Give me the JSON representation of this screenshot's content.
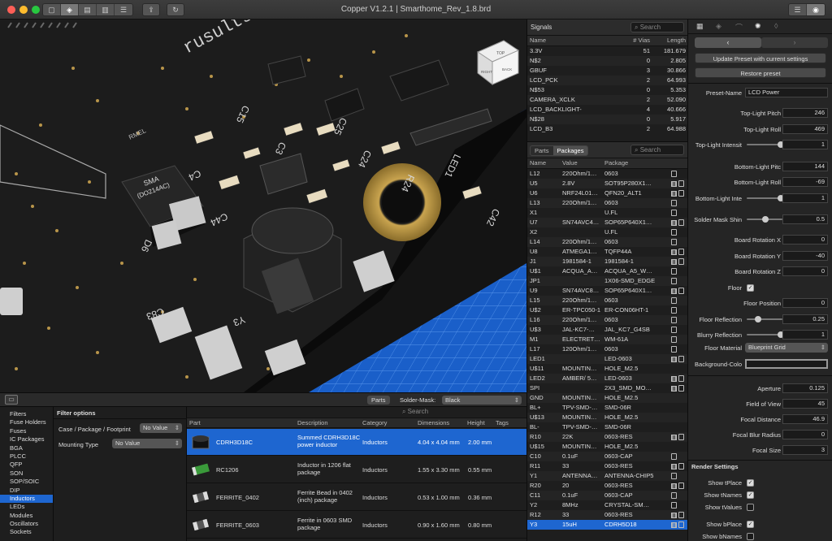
{
  "window": {
    "title": "Copper V1.2.1 | Smarthome_Rev_1.8.brd"
  },
  "colors": {
    "accent": "#1e66d0",
    "board": "#1b1b1b",
    "floor": "#1a5fc9"
  },
  "viewport": {
    "cube_top": "TOP",
    "cube_right": "RIGHT",
    "cube_back": "BACK",
    "silk_rusults": "rusults.com",
    "silk_rmel": "RMEL",
    "silk_sma": "SMA",
    "silk_sma2": "(DO214AC)",
    "labels": [
      "C4",
      "C44",
      "C42",
      "C83",
      "Y3",
      "D6",
      "R24",
      "C24",
      "C25",
      "C15",
      "C3",
      "LED1"
    ]
  },
  "signals": {
    "title": "Signals",
    "search_placeholder": "Search",
    "columns": {
      "name": "Name",
      "vias": "# Vias",
      "length": "Length"
    },
    "rows": [
      {
        "name": "3.3V",
        "vias": "51",
        "length": "181.679"
      },
      {
        "name": "N$2",
        "vias": "0",
        "length": "2.805"
      },
      {
        "name": "GBUF",
        "vias": "3",
        "length": "30.866"
      },
      {
        "name": "LCD_PCK",
        "vias": "2",
        "length": "64.993"
      },
      {
        "name": "N$53",
        "vias": "0",
        "length": "5.353"
      },
      {
        "name": "CAMERA_XCLK",
        "vias": "2",
        "length": "52.090"
      },
      {
        "name": "LCD_BACKLIGHT-",
        "vias": "4",
        "length": "40.666"
      },
      {
        "name": "N$28",
        "vias": "0",
        "length": "5.917"
      },
      {
        "name": "LCD_B3",
        "vias": "2",
        "length": "64.988"
      }
    ]
  },
  "parts_panel": {
    "tab_parts": "Parts",
    "tab_packages": "Packages",
    "search_placeholder": "Search",
    "columns": {
      "name": "Name",
      "value": "Value",
      "package": "Package"
    },
    "rows": [
      {
        "name": "L12",
        "value": "220Ohm/1…",
        "package": "0603",
        "icons": 1
      },
      {
        "name": "U5",
        "value": "2.8V",
        "package": "SOT95P280X1…",
        "icons": 2
      },
      {
        "name": "U6",
        "value": "NRF24L01…",
        "package": "QFN20_ALT1",
        "icons": 2
      },
      {
        "name": "L13",
        "value": "220Ohm/1…",
        "package": "0603",
        "icons": 1
      },
      {
        "name": "X1",
        "value": "",
        "package": "U.FL",
        "icons": 1
      },
      {
        "name": "U7",
        "value": "SN74AVC4…",
        "package": "SOP65P640X1…",
        "icons": 2
      },
      {
        "name": "X2",
        "value": "",
        "package": "U.FL",
        "icons": 1
      },
      {
        "name": "L14",
        "value": "220Ohm/1…",
        "package": "0603",
        "icons": 1
      },
      {
        "name": "U8",
        "value": "ATMEGA1…",
        "package": "TQFP44A",
        "icons": 2
      },
      {
        "name": "J1",
        "value": "1981584-1",
        "package": "1981584-1",
        "icons": 2
      },
      {
        "name": "U$1",
        "value": "ACQUA_A…",
        "package": "ACQUA_A5_W…",
        "icons": 1
      },
      {
        "name": "JP1",
        "value": "",
        "package": "1X06-SMD_EDGE",
        "icons": 1
      },
      {
        "name": "U9",
        "value": "SN74AVC8…",
        "package": "SOP65P640X1…",
        "icons": 2
      },
      {
        "name": "L15",
        "value": "220Ohm/1…",
        "package": "0603",
        "icons": 1
      },
      {
        "name": "U$2",
        "value": "ER-TPC050-1",
        "package": "ER-CON06HT-1",
        "icons": 1
      },
      {
        "name": "L16",
        "value": "220Ohm/1…",
        "package": "0603",
        "icons": 1
      },
      {
        "name": "U$3",
        "value": "JAL-KC7-…",
        "package": "JAL_KC7_G4SB",
        "icons": 1
      },
      {
        "name": "M1",
        "value": "ELECTRET…",
        "package": "WM-61A",
        "icons": 1
      },
      {
        "name": "L17",
        "value": "120Ohm/1…",
        "package": "0603",
        "icons": 1
      },
      {
        "name": "LED1",
        "value": "",
        "package": "LED-0603",
        "icons": 2
      },
      {
        "name": "U$11",
        "value": "MOUNTIN…",
        "package": "HOLE_M2.5",
        "icons": 0
      },
      {
        "name": "LED2",
        "value": "AMBER/ 5…",
        "package": "LED-0603",
        "icons": 2
      },
      {
        "name": "SPI",
        "value": "",
        "package": "2X3_SMD_MO…",
        "icons": 2
      },
      {
        "name": "GND",
        "value": "MOUNTIN…",
        "package": "HOLE_M2.5",
        "icons": 0
      },
      {
        "name": "BL+",
        "value": "TPV-SMD-…",
        "package": "SMD-06R",
        "icons": 0
      },
      {
        "name": "U$13",
        "value": "MOUNTIN…",
        "package": "HOLE_M2.5",
        "icons": 0
      },
      {
        "name": "BL-",
        "value": "TPV-SMD-…",
        "package": "SMD-06R",
        "icons": 0
      },
      {
        "name": "R10",
        "value": "22K",
        "package": "0603-RES",
        "icons": 2
      },
      {
        "name": "U$15",
        "value": "MOUNTIN…",
        "package": "HOLE_M2.5",
        "icons": 0
      },
      {
        "name": "C10",
        "value": "0.1uF",
        "package": "0603-CAP",
        "icons": 1
      },
      {
        "name": "R11",
        "value": "33",
        "package": "0603-RES",
        "icons": 2
      },
      {
        "name": "Y1",
        "value": "ANTENNA…",
        "package": "ANTENNA-CHIP5",
        "icons": 1
      },
      {
        "name": "R20",
        "value": "20",
        "package": "0603-RES",
        "icons": 2
      },
      {
        "name": "C11",
        "value": "0.1uF",
        "package": "0603-CAP",
        "icons": 1
      },
      {
        "name": "Y2",
        "value": "8MHz",
        "package": "CRYSTAL-SM…",
        "icons": 1
      },
      {
        "name": "R12",
        "value": "33",
        "package": "0603-RES",
        "icons": 2
      },
      {
        "name": "Y3",
        "value": "15uH",
        "package": "CDRH5D18",
        "icons": 2
      }
    ],
    "selected_index": 36
  },
  "inspector": {
    "tab_icons": [
      "grid-icon",
      "layers-icon",
      "curve-icon",
      "bulb-icon",
      "eraser-icon"
    ],
    "update_btn": "Update Preset with current settings",
    "restore_btn": "Restore preset",
    "preset_name_label": "Preset-Name",
    "preset_name": "LCD Power",
    "fields": [
      {
        "label": "Top-Light Pitch",
        "value": "246",
        "slider": null
      },
      {
        "label": "Top-Light Roll",
        "value": "469",
        "slider": null
      },
      {
        "label": "Top-Light Intensit",
        "value": "1",
        "slider": 1.0
      },
      {
        "label": "Bottom-Light Pitc",
        "value": "144",
        "slider": null
      },
      {
        "label": "Bottom-Light Roll",
        "value": "-69",
        "slider": null
      },
      {
        "label": "Bottom-Light Inte",
        "value": "1",
        "slider": 1.0
      },
      {
        "label": "Solder Mask Shin",
        "value": "0.5",
        "slider": 0.5
      },
      {
        "label": "Board Rotation X",
        "value": "0",
        "slider": null
      },
      {
        "label": "Board Rotation Y",
        "value": "-40",
        "slider": null
      },
      {
        "label": "Board Rotation Z",
        "value": "0",
        "slider": null
      }
    ],
    "floor_label": "Floor",
    "floor_checked": true,
    "floor_fields": [
      {
        "label": "Floor Position",
        "value": "0",
        "slider": null
      },
      {
        "label": "Floor Reflection",
        "value": "0.25",
        "slider": 0.25
      },
      {
        "label": "Blurry Reflection",
        "value": "1",
        "slider": 1.0
      }
    ],
    "floor_material_label": "Floor Material",
    "floor_material": "Blueprint Grid",
    "background_label": "Background-Colo",
    "camera_fields": [
      {
        "label": "Aperture",
        "value": "0.125"
      },
      {
        "label": "Field of View",
        "value": "45"
      },
      {
        "label": "Focal Distance",
        "value": "46.9"
      },
      {
        "label": "Focal Blur Radius",
        "value": "0"
      },
      {
        "label": "Focal Size",
        "value": "3"
      }
    ],
    "render_settings_title": "Render Settings",
    "render_checks": [
      {
        "label": "Show tPlace",
        "checked": true
      },
      {
        "label": "Show tNames",
        "checked": true
      },
      {
        "label": "Show tValues",
        "checked": false
      },
      {
        "label": "Show bPlace",
        "checked": true
      },
      {
        "label": "Show bNames",
        "checked": false
      }
    ]
  },
  "library": {
    "toggle_parts": "Parts",
    "solder_mask_label": "Solder-Mask:",
    "solder_mask_value": "Black",
    "categories": [
      "Filters",
      "Fuse Holders",
      "Fuses",
      "IC Packages",
      "BGA",
      "PLCC",
      "QFP",
      "SON",
      "SOP/SOIC",
      "DIP",
      "Inductors",
      "LEDs",
      "Modules",
      "Oscillators",
      "Sockets"
    ],
    "selected_category": 10,
    "filter_title": "Filter options",
    "filter_case_label": "Case / Package / Footprint",
    "filter_case_value": "No Value",
    "filter_mount_label": "Mounting Type",
    "filter_mount_value": "No Value",
    "search_placeholder": "Search",
    "columns": {
      "part": "Part",
      "description": "Description",
      "category": "Category",
      "dimensions": "Dimensions",
      "height": "Height",
      "tags": "Tags"
    },
    "rows": [
      {
        "part": "CDRH3D18C",
        "description": "Summed CDRH3D18C power inductor",
        "category": "Inductors",
        "dimensions": "4.04 x 4.04 mm",
        "height": "2.00 mm",
        "thumb": "inductor-thumb"
      },
      {
        "part": "RC1206",
        "description": "Inductor in 1206 flat package",
        "category": "Inductors",
        "dimensions": "1.55 x 3.30 mm",
        "height": "0.55 mm",
        "thumb": "smd-green-thumb"
      },
      {
        "part": "FERRITE_0402",
        "description": "Ferrite Bead in 0402 (inch) package",
        "category": "Inductors",
        "dimensions": "0.53 x 1.00 mm",
        "height": "0.36 mm",
        "thumb": "ferrite-thumb"
      },
      {
        "part": "FERRITE_0603",
        "description": "Ferrite in 0603 SMD package",
        "category": "Inductors",
        "dimensions": "0.90 x 1.60 mm",
        "height": "0.80 mm",
        "thumb": "ferrite-thumb"
      }
    ],
    "selected_row": 0
  }
}
